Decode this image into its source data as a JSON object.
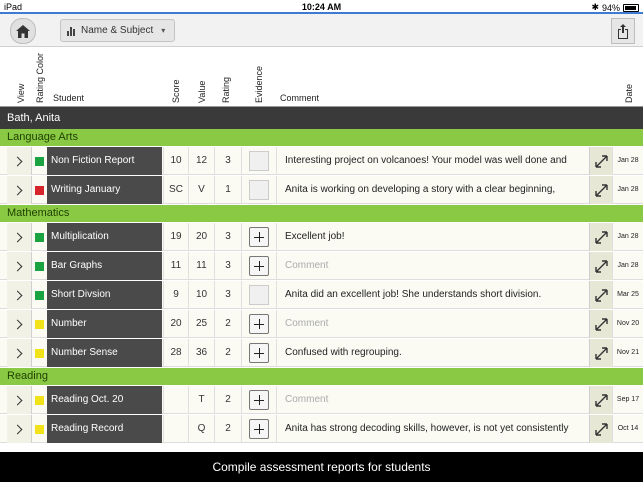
{
  "status_bar": {
    "device": "iPad",
    "time": "10:24 AM",
    "battery": "94%"
  },
  "toolbar": {
    "sort_label": "Name & Subject"
  },
  "columns": {
    "view": "View",
    "rating_color": "Rating Color",
    "student": "Student",
    "score": "Score",
    "value": "Value",
    "rating": "Rating",
    "evidence": "Evidence",
    "comment": "Comment",
    "date": "Date"
  },
  "student_name": "Bath, Anita",
  "sections": [
    {
      "title": "Language Arts",
      "rows": [
        {
          "label": "Non Fiction Report",
          "color": "#1aa340",
          "score": "10",
          "value": "12",
          "rating": "3",
          "evidence": "thumbnail",
          "comment": "Interesting project on volcanoes! Your model was well done and",
          "date": "Jan 28"
        },
        {
          "label": "Writing January",
          "color": "#d7262b",
          "score": "SC",
          "value": "V",
          "rating": "1",
          "evidence": "thumbnail",
          "comment": "Anita is working on developing a story with a clear beginning,",
          "date": "Jan 28"
        }
      ]
    },
    {
      "title": "Mathematics",
      "rows": [
        {
          "label": "Multiplication",
          "color": "#1aa340",
          "score": "19",
          "value": "20",
          "rating": "3",
          "evidence": "add",
          "comment": "Excellent job!",
          "date": "Jan 28"
        },
        {
          "label": "Bar Graphs",
          "color": "#1aa340",
          "score": "11",
          "value": "11",
          "rating": "3",
          "evidence": "add",
          "comment": "Comment",
          "placeholder": true,
          "date": "Jan 28"
        },
        {
          "label": "Short Divsion",
          "color": "#1aa340",
          "score": "9",
          "value": "10",
          "rating": "3",
          "evidence": "thumbnail",
          "comment": "Anita did an excellent job! She understands short division.",
          "date": "Mar 25"
        },
        {
          "label": "Number",
          "color": "#f2e21a",
          "score": "20",
          "value": "25",
          "rating": "2",
          "evidence": "add",
          "comment": "Comment",
          "placeholder": true,
          "date": "Nov 20"
        },
        {
          "label": "Number Sense",
          "color": "#f2e21a",
          "score": "28",
          "value": "36",
          "rating": "2",
          "evidence": "add",
          "comment": "Confused with regrouping.",
          "date": "Nov 21"
        }
      ]
    },
    {
      "title": "Reading",
      "rows": [
        {
          "label": "Reading Oct. 20",
          "color": "#f2e21a",
          "score": "",
          "value": "T",
          "rating": "2",
          "evidence": "add",
          "comment": "Comment",
          "placeholder": true,
          "date": "Sep 17"
        },
        {
          "label": "Reading Record",
          "color": "#f2e21a",
          "score": "",
          "value": "Q",
          "rating": "2",
          "evidence": "add",
          "comment": "Anita has strong decoding skills, however, is not yet consistently",
          "date": "Oct 14"
        }
      ]
    }
  ],
  "caption": "Compile assessment reports for students"
}
